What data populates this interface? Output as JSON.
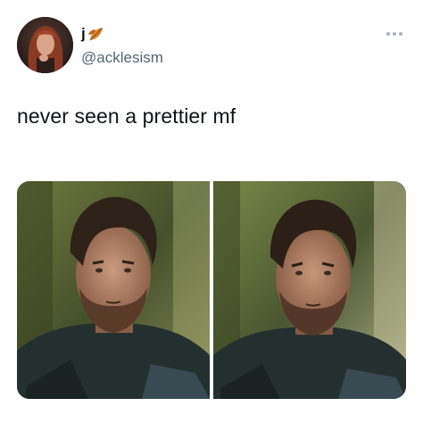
{
  "tweet": {
    "display_name": "j",
    "display_name_emoji": "leaf-icon",
    "handle": "@acklesism",
    "text": "never seen a prettier mf",
    "more_icon": "more-horizontal-icon",
    "media": [
      {
        "label": "photo-1"
      },
      {
        "label": "photo-2"
      }
    ]
  },
  "colors": {
    "text_primary": "#0f1419",
    "text_secondary": "#536471",
    "background": "#ffffff"
  }
}
